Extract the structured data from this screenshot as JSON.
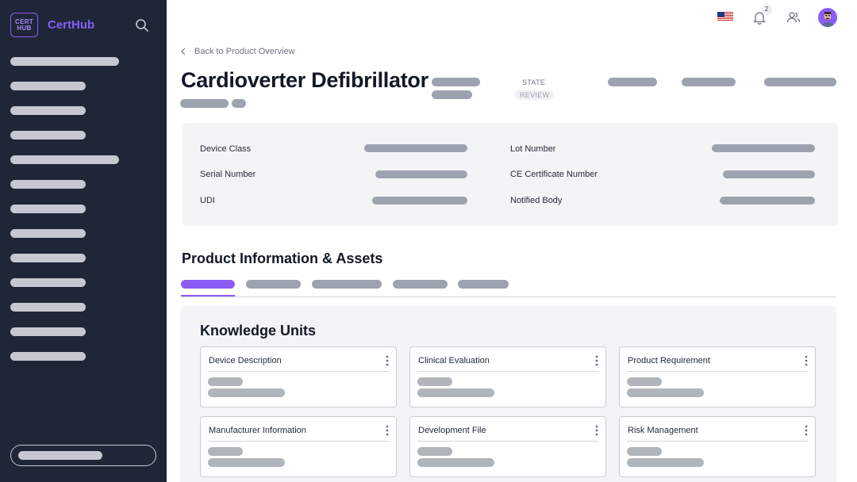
{
  "app": {
    "logo_line1": "CERT",
    "logo_line2": "HUB",
    "brand": "CertHub"
  },
  "topbar": {
    "notification_count": "2"
  },
  "back_link": "Back to Product Overview",
  "product": {
    "title": "Cardioverter Defibrillator",
    "state_label": "STATE",
    "state_value": "REVIEW"
  },
  "details": {
    "device_class_label": "Device Class",
    "serial_number_label": "Serial Number",
    "udi_label": "UDI",
    "lot_number_label": "Lot Number",
    "ce_certificate_label": "CE Certificate Number",
    "notified_body_label": "Notified Body"
  },
  "section": {
    "title": "Product Information & Assets",
    "panel_title": "Knowledge Units"
  },
  "knowledge_units": [
    "Device Description",
    "Clinical Evaluation",
    "Product Requirement",
    "Manufacturer Information",
    "Development File",
    "Risk Management"
  ],
  "colors": {
    "sidebar_bg": "#1f2638",
    "accent": "#8b5cf6",
    "skeleton": "#9ca3af",
    "panel_bg": "#f3f4f6"
  }
}
